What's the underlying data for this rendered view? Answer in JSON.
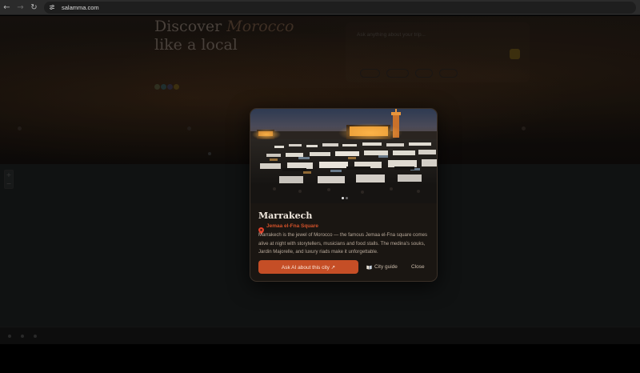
{
  "browser": {
    "url": "salamma.com",
    "icons": [
      "back-arrow-icon",
      "forward-arrow-icon",
      "reload-icon",
      "site-settings-icon"
    ]
  },
  "hero": {
    "title_line1": "Discover",
    "title_accent": "Morocco",
    "title_line2": "like a local",
    "subtitle": "",
    "stat_text": ""
  },
  "ask": {
    "placeholder": "Ask anything about your trip..."
  },
  "modal": {
    "title": "Marrakech",
    "location": "Jemaa el-Fna Square",
    "description": "Marrakech is the jewel of Morocco — the famous Jemaa el-Fna square comes alive at night with storytellers, musicians and food stalls. The medina's souks, Jardin Majorelle, and luxury riads make it unforgettable.",
    "ask_ai_label": "Ask AI about this city ↗",
    "city_guide_label": "City guide",
    "close_label": "Close",
    "carousel": {
      "count": 2,
      "active_index": 0
    },
    "accent_color": "#c54e26",
    "location_color": "#d0512a"
  },
  "map": {
    "zoom_in": "+",
    "zoom_out": "−"
  }
}
